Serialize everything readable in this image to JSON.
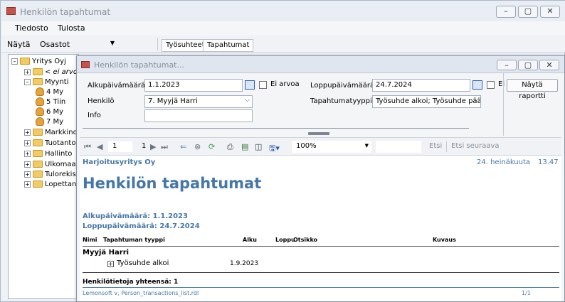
{
  "outer_window": {
    "title": "Henkilön tapahtumat",
    "controls": {
      "minimize": "–",
      "maximize": "▢",
      "close": "✕"
    }
  },
  "menu": [
    "Tiedosto",
    "Tulosta"
  ],
  "toolbar": {
    "show_label": "Näytä",
    "show_value": "Osastot",
    "tabs": [
      "Työsuhteet",
      "Tapahtumat"
    ]
  },
  "tree": {
    "root": "Yritys Oyj",
    "nodes": [
      {
        "label": "< ei arvoa",
        "type": "folder",
        "italic": true,
        "indent": 1,
        "expander": "+"
      },
      {
        "label": "Myynti",
        "type": "folder",
        "indent": 1,
        "expander": "–"
      },
      {
        "label": "4 My",
        "type": "person",
        "indent": 2
      },
      {
        "label": "5 Tiin",
        "type": "person",
        "indent": 2
      },
      {
        "label": "6 My",
        "type": "person",
        "indent": 2
      },
      {
        "label": "7 My",
        "type": "person",
        "indent": 2
      },
      {
        "label": "Markkino",
        "type": "folder",
        "indent": 1,
        "expander": "+"
      },
      {
        "label": "Tuotanto",
        "type": "folder",
        "indent": 1,
        "expander": "+"
      },
      {
        "label": "Hallinto",
        "type": "folder",
        "indent": 1,
        "expander": "+"
      },
      {
        "label": "Ulkomaa",
        "type": "folder",
        "indent": 1,
        "expander": "+"
      },
      {
        "label": "Tulorekis",
        "type": "folder",
        "indent": 1,
        "expander": "+"
      },
      {
        "label": "Lopettan",
        "type": "folder",
        "indent": 1,
        "expander": "+"
      }
    ]
  },
  "inner_window": {
    "title": "Henkilön tapahtumat..."
  },
  "form": {
    "start_label": "Alkupäivämäärä",
    "start_value": "1.1.2023",
    "no_value_label": "Ei arvoa",
    "end_label": "Loppupäivämäärä",
    "end_value": "24.7.2024",
    "end_checkbox_label": "Ei",
    "person_label": "Henkilö",
    "person_value": "7. Myyjä Harri",
    "type_label": "Tapahtumatyyppi",
    "type_value": "Työsuhde alkoi; Työsuhde pää",
    "info_label": "Info",
    "info_value": "",
    "show_report_button": "Näytä raportti"
  },
  "report_toolbar": {
    "page_current": "1",
    "page_total": "1",
    "zoom": "100%",
    "search_value": "",
    "find": "Etsi",
    "find_next": "Etsi seuraava"
  },
  "report": {
    "company": "Harjoitusyritys Oy",
    "date": "24. heinäkuuta",
    "time": "13.47",
    "title": "Henkilön tapahtumat",
    "start_line": "Alkupäivämäärä: 1.1.2023",
    "end_line": "Loppupäivämäärä: 24.7.2024",
    "headers": {
      "name": "Nimi",
      "type": "Tapahtuman tyyppi",
      "start": "Alku",
      "end": "Loppu",
      "heading": "Otsikko",
      "description": "Kuvaus"
    },
    "person": "Myyjä Harri",
    "event_type": "Työsuhde alkoi",
    "event_start": "1.9.2023",
    "total": "Henkilötietoja yhteensä: 1",
    "footer_left": "Lemonsoft v, Person_transactions_list.rdl",
    "footer_right": "1/1"
  },
  "colors": {
    "accent": "#4577a8",
    "folder": "#f2cc63",
    "person": "#e7a23a"
  }
}
